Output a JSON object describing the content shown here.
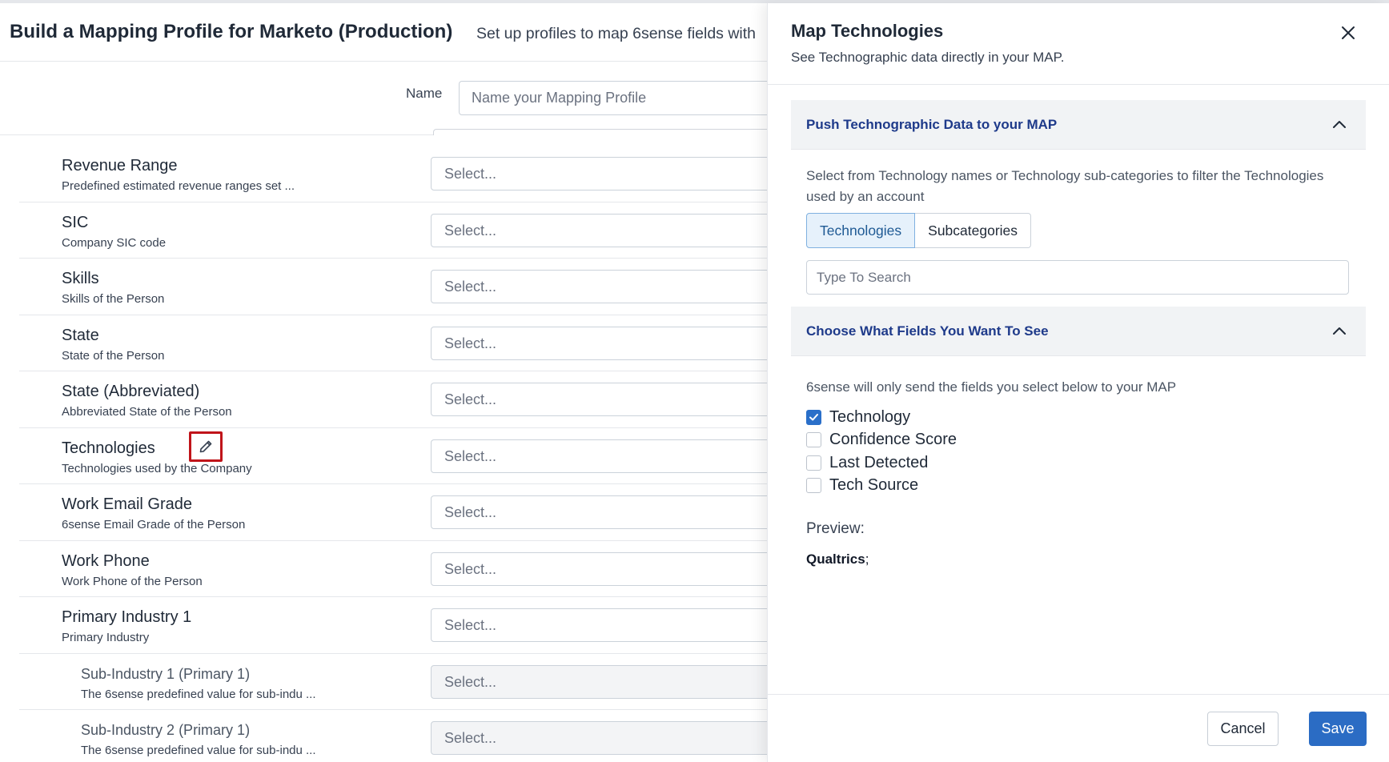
{
  "page": {
    "title": "Build a Mapping Profile for Marketo (Production)",
    "subtitle": "Set up profiles to map 6sense fields with",
    "name_label": "Name",
    "name_placeholder": "Name your Mapping Profile"
  },
  "fields": [
    {
      "name": "Revenue Range",
      "desc": "Predefined estimated revenue ranges set ...",
      "select": "Select..."
    },
    {
      "name": "SIC",
      "desc": "Company SIC code",
      "select": "Select..."
    },
    {
      "name": "Skills",
      "desc": "Skills of the Person",
      "select": "Select..."
    },
    {
      "name": "State",
      "desc": "State of the Person",
      "select": "Select..."
    },
    {
      "name": "State (Abbreviated)",
      "desc": "Abbreviated State of the Person",
      "select": "Select..."
    },
    {
      "name": "Technologies",
      "desc": "Technologies used by the Company",
      "select": "Select..."
    },
    {
      "name": "Work Email Grade",
      "desc": "6sense Email Grade of the Person",
      "select": "Select..."
    },
    {
      "name": "Work Phone",
      "desc": "Work Phone of the Person",
      "select": "Select..."
    },
    {
      "name": "Primary Industry 1",
      "desc": "Primary Industry",
      "select": "Select..."
    },
    {
      "name": "Sub-Industry 1 (Primary 1)",
      "desc": "The 6sense predefined value for sub-indu ...",
      "select": "Select..."
    },
    {
      "name": "Sub-Industry 2 (Primary 1)",
      "desc": "The 6sense predefined value for sub-indu ...",
      "select": "Select..."
    }
  ],
  "drawer": {
    "title": "Map Technologies",
    "subtitle": "See Technographic data directly in your MAP.",
    "section1": {
      "title": "Push Technographic Data to your MAP",
      "description": "Select from Technology names or Technology sub-categories to filter the Technologies used by an account",
      "tabs": [
        "Technologies",
        "Subcategories"
      ],
      "search_placeholder": "Type To Search"
    },
    "section2": {
      "title": "Choose What Fields You Want To See",
      "description": "6sense will only send the fields you select below to your MAP",
      "options": [
        {
          "label": "Technology",
          "checked": true
        },
        {
          "label": "Confidence Score",
          "checked": false
        },
        {
          "label": "Last Detected",
          "checked": false
        },
        {
          "label": "Tech Source",
          "checked": false
        }
      ],
      "preview_label": "Preview:",
      "preview_value": "Qualtrics",
      "preview_suffix": ";"
    },
    "cancel_label": "Cancel",
    "save_label": "Save"
  },
  "colors": {
    "accent": "#2b6cc4",
    "section_title": "#1e3a8a",
    "highlight": "#c0141a"
  }
}
